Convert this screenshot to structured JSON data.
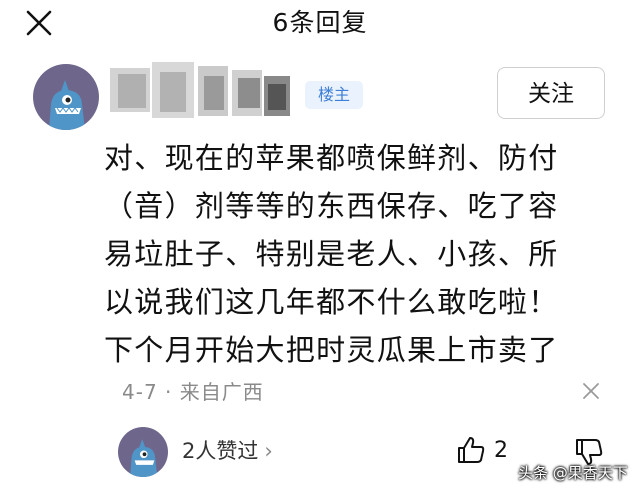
{
  "header": {
    "title": "6条回复",
    "close_icon": "close-icon"
  },
  "post": {
    "badge": "楼主",
    "follow_label": "关注",
    "lines": [
      "对、现在的苹果都喷保鲜剂、防付",
      "（音）剂等等的东西保存、吃了容",
      "易垃肚子、特别是老人、小孩、所",
      "以说我们这几年都不什么敢吃啦！",
      "下个月开始大把时灵瓜果上市卖了"
    ],
    "meta": "4-7 · 来自广西"
  },
  "likes": {
    "text": "2人赞过",
    "chevron": "›",
    "count": "2"
  },
  "watermark": "头条 @果香天下",
  "colors": {
    "avatar_bg": "#6f668c",
    "avatar_figure": "#4f95c7",
    "badge_bg": "#e9f2fd",
    "badge_text": "#3f7fd6"
  }
}
